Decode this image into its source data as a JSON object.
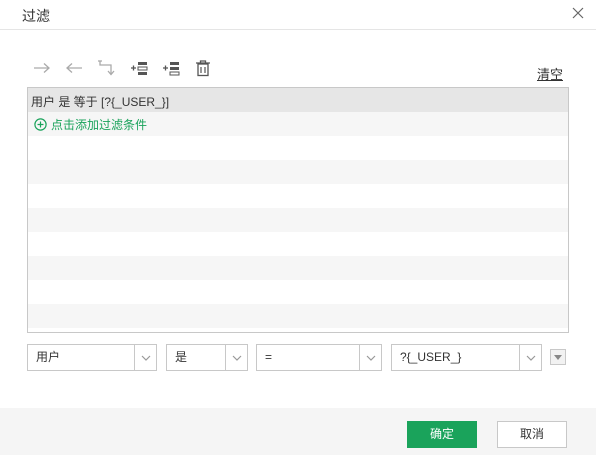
{
  "dialog": {
    "title": "过滤",
    "close_icon": "close-icon"
  },
  "toolbar": {
    "tools": [
      "indent-right-icon",
      "indent-left-icon",
      "wrap-icon",
      "insert-above-icon",
      "insert-below-icon",
      "delete-icon"
    ],
    "clear_label": "清空"
  },
  "filter_list": {
    "conditions": [
      "用户 是 等于 [?{_USER_}]"
    ],
    "add_label": "点击添加过滤条件"
  },
  "editor": {
    "field": "用户",
    "relation": "是",
    "operator": "=",
    "value": "?{_USER_}"
  },
  "footer": {
    "ok_label": "确定",
    "cancel_label": "取消"
  },
  "colors": {
    "accent": "#1aa35b",
    "border": "#c8c8c8",
    "selected_row": "#e6e6e6",
    "alt_row": "#f6f6f6"
  }
}
